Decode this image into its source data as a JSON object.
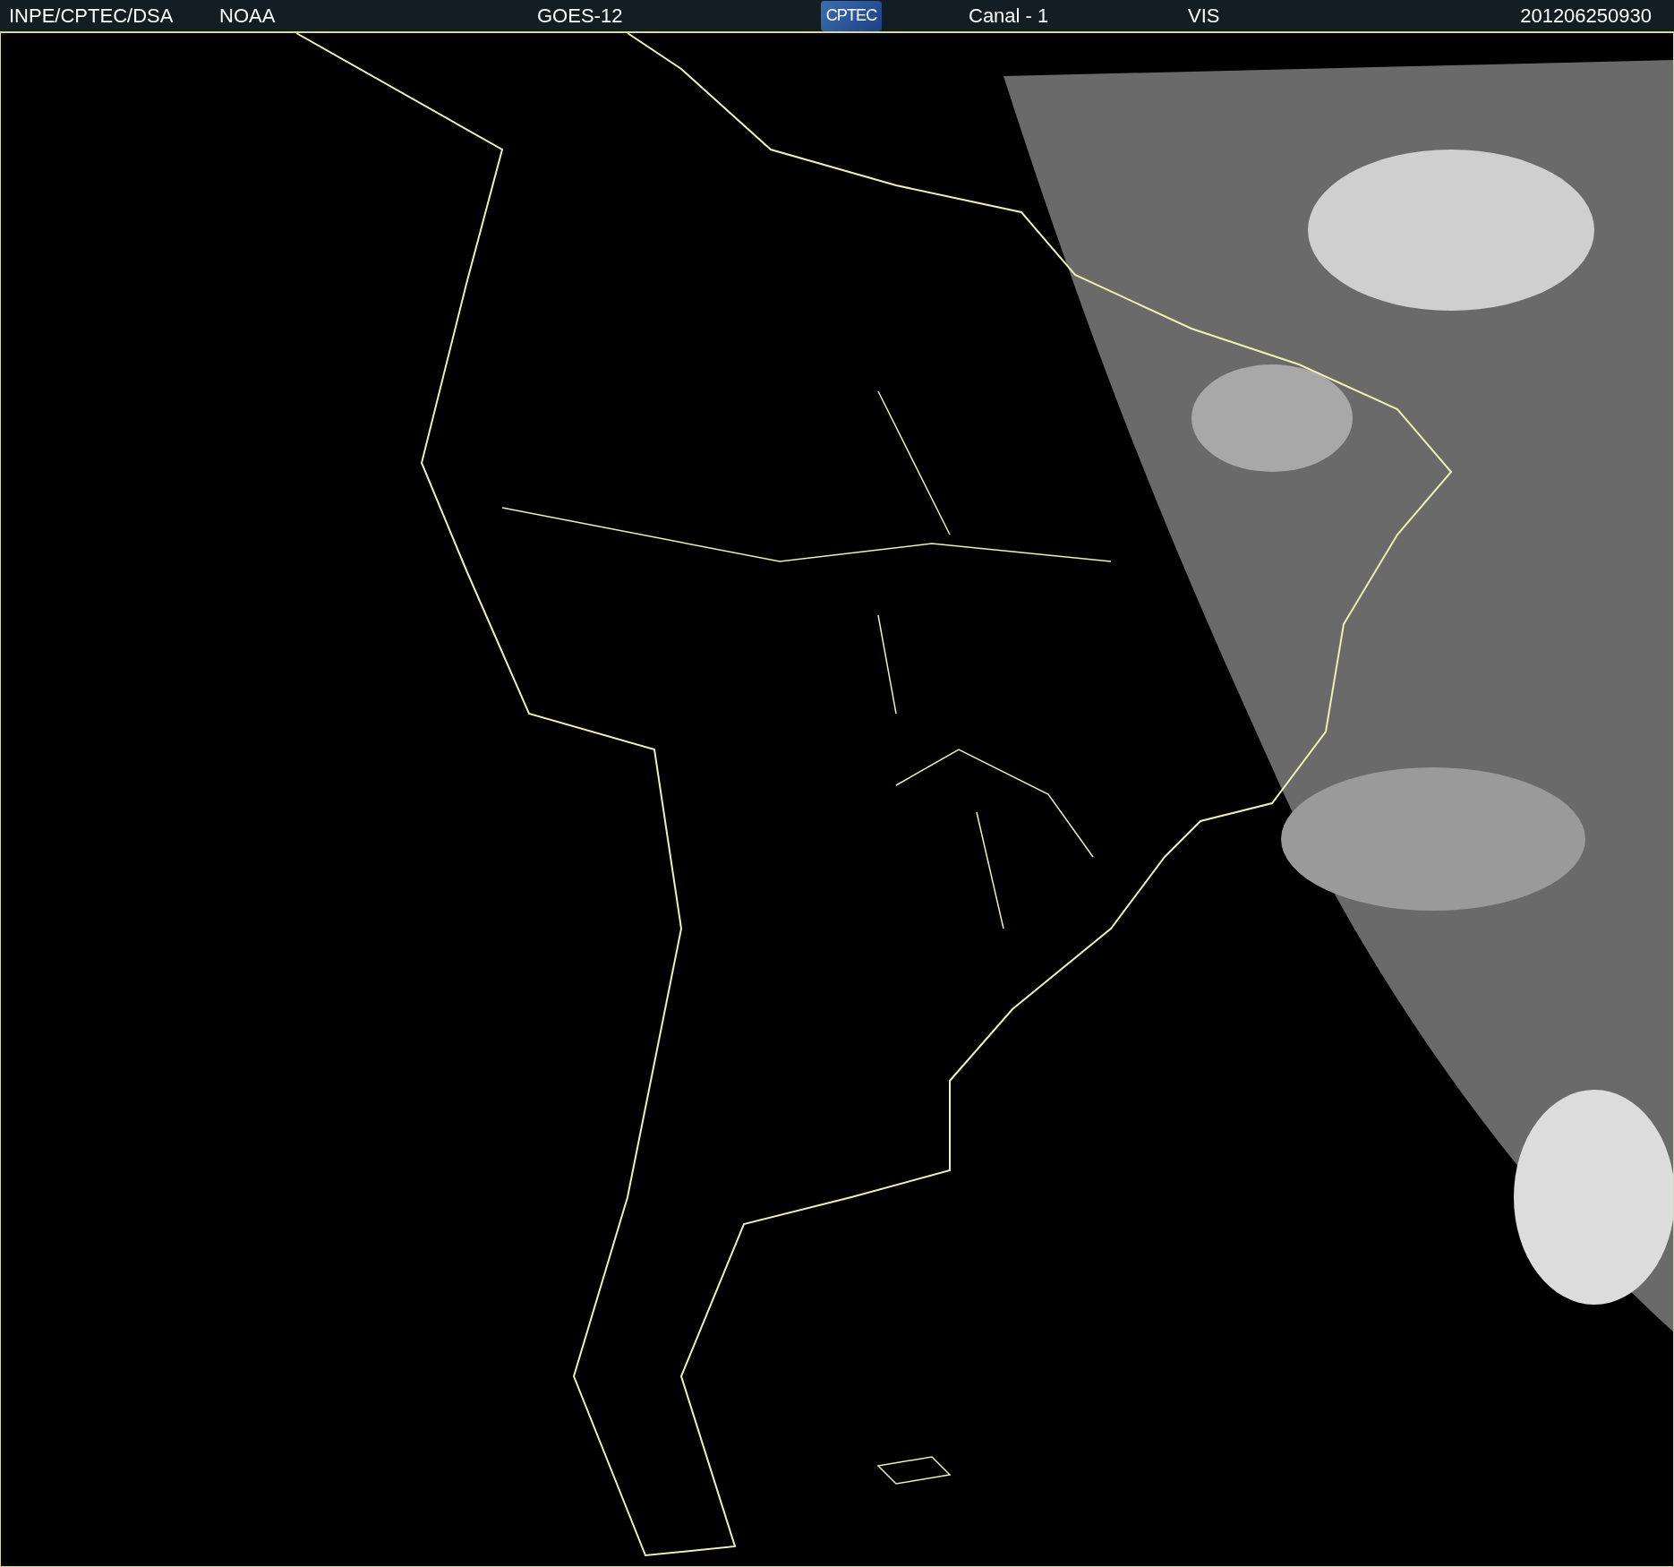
{
  "header": {
    "source": "INPE/CPTEC/DSA",
    "agency": "NOAA",
    "satellite": "GOES-12",
    "logo_text": "CPTEC",
    "channel": "Canal - 1",
    "band": "VIS",
    "timestamp": "201206250930"
  }
}
